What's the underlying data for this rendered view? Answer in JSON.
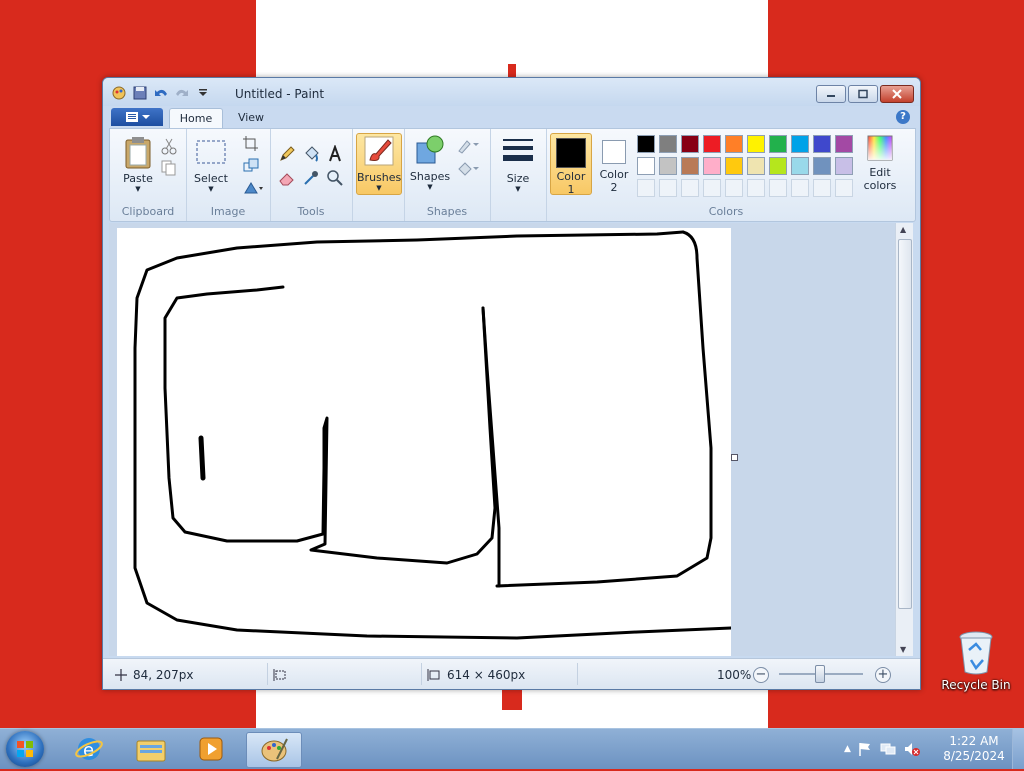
{
  "app": {
    "title": "Untitled - Paint"
  },
  "tabs": {
    "home": "Home",
    "view": "View",
    "help": "?"
  },
  "ribbon": {
    "clipboard": {
      "label": "Clipboard",
      "paste": "Paste"
    },
    "image": {
      "label": "Image",
      "select": "Select"
    },
    "tools": {
      "label": "Tools"
    },
    "brushes": {
      "label": "Brushes"
    },
    "shapes": {
      "label": "Shapes",
      "button": "Shapes"
    },
    "size": {
      "label": "Size"
    },
    "color1": {
      "label": "Color",
      "sub": "1",
      "value": "#000000"
    },
    "color2": {
      "label": "Color",
      "sub": "2",
      "value": "#ffffff"
    },
    "colors_group": "Colors",
    "edit_colors": {
      "line1": "Edit",
      "line2": "colors"
    },
    "palette_row1": [
      "#000000",
      "#7f7f7f",
      "#880015",
      "#ed1c24",
      "#ff7f27",
      "#fff200",
      "#22b14c",
      "#00a2e8",
      "#3f48cc",
      "#a349a4"
    ],
    "palette_row2": [
      "#ffffff",
      "#c3c3c3",
      "#b97a57",
      "#ffaec9",
      "#ffc90e",
      "#efe4b0",
      "#b5e61d",
      "#99d9ea",
      "#7092be",
      "#c8bfe7"
    ]
  },
  "status": {
    "cursor_pos": "84, 207px",
    "image_size": "614 × 460px",
    "zoom": "100%",
    "zoom_minus": "−",
    "zoom_plus": "+"
  },
  "desktop": {
    "recycle_bin": "Recycle Bin"
  },
  "taskbar": {
    "time": "1:22 AM",
    "date": "8/25/2024"
  }
}
